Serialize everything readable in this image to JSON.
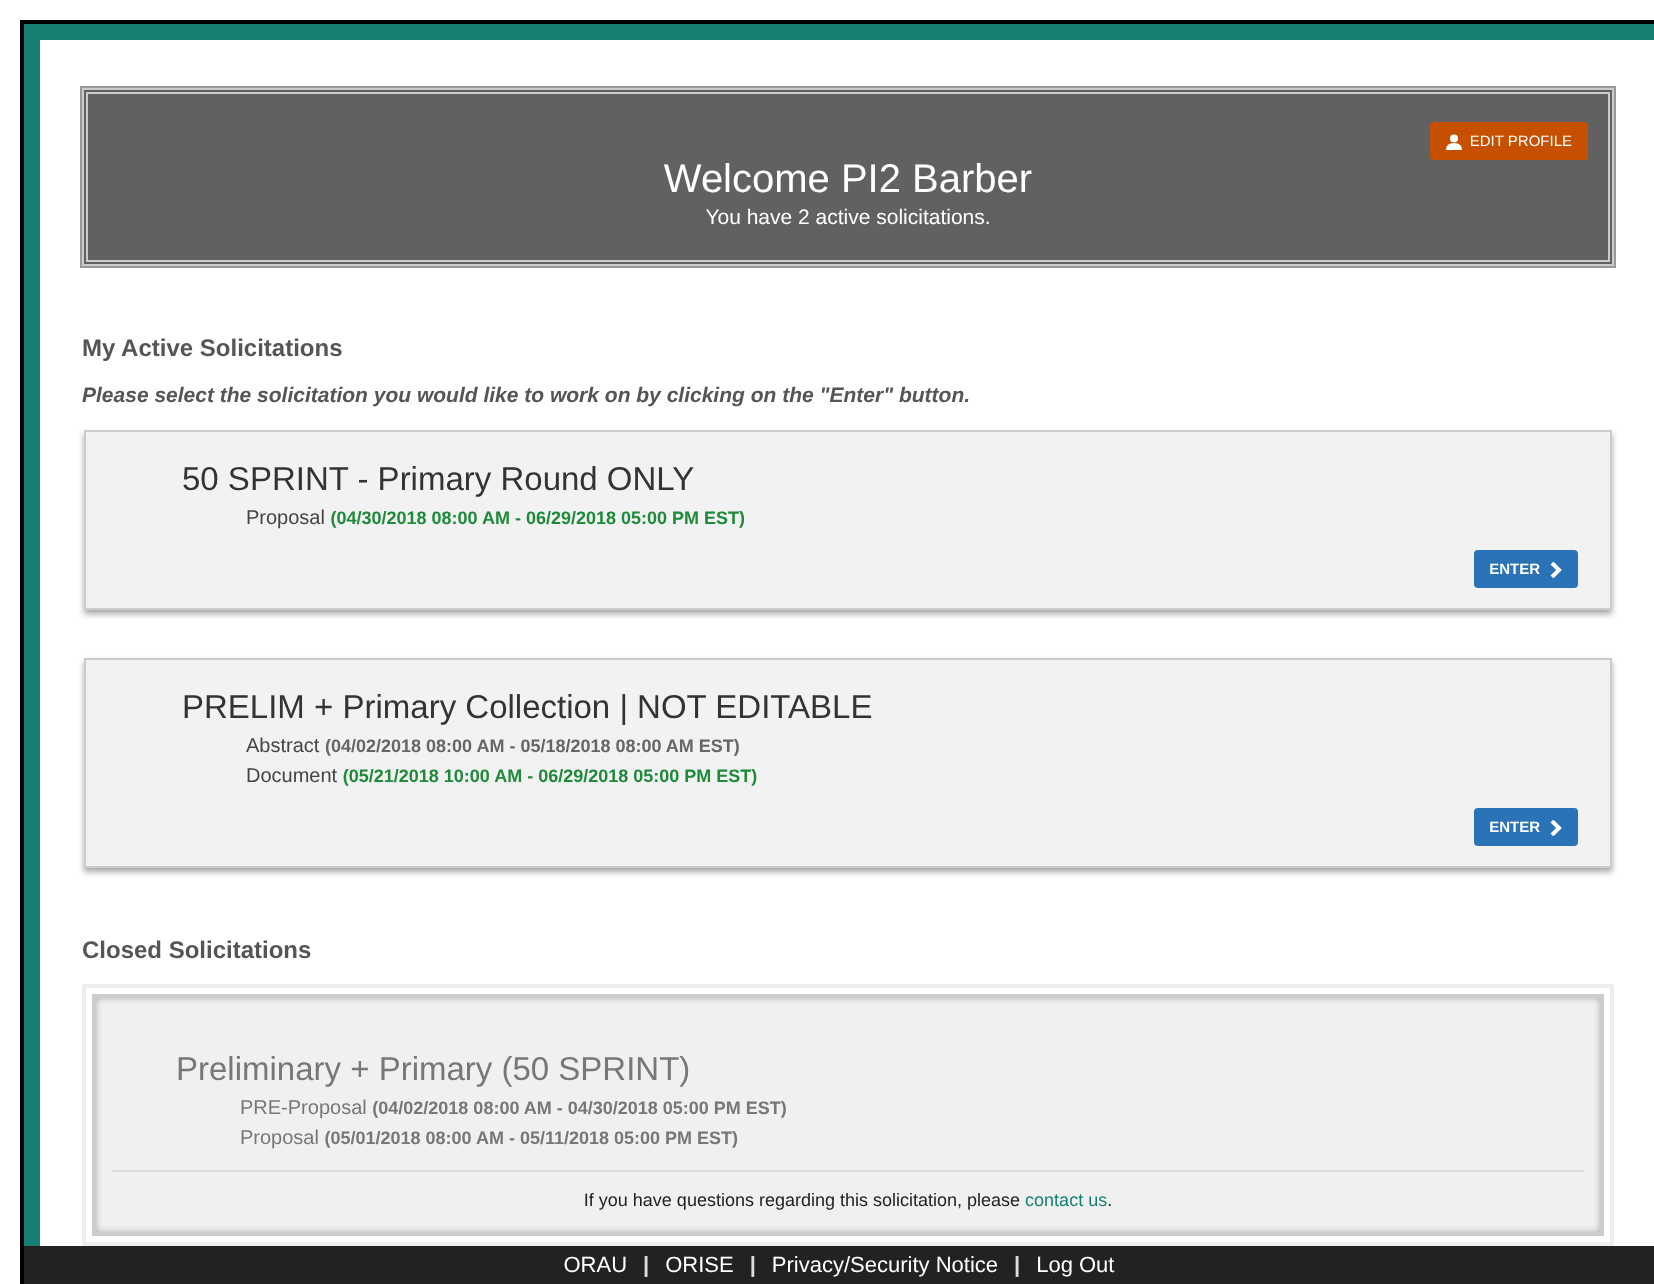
{
  "header": {
    "title": "Welcome PI2 Barber",
    "subtitle": "You have 2 active solicitations.",
    "edit_button": "EDIT PROFILE"
  },
  "active": {
    "heading": "My Active Solicitations",
    "instruction": "Please select the solicitation you would like to work on by clicking on the \"Enter\" button.",
    "solicitations": [
      {
        "title": "50 SPRINT - Primary Round ONLY",
        "phases": [
          {
            "name": "Proposal",
            "dates": "(04/30/2018 08:00 AM - 06/29/2018 05:00 PM EST)",
            "open": true
          }
        ],
        "button": "ENTER"
      },
      {
        "title": "PRELIM + Primary Collection | NOT EDITABLE",
        "phases": [
          {
            "name": "Abstract",
            "dates": "(04/02/2018 08:00 AM - 05/18/2018 08:00 AM EST)",
            "open": false
          },
          {
            "name": "Document",
            "dates": "(05/21/2018 10:00 AM - 06/29/2018 05:00 PM EST)",
            "open": true
          }
        ],
        "button": "ENTER"
      }
    ]
  },
  "closed": {
    "heading": "Closed Solicitations",
    "solicitations": [
      {
        "title": "Preliminary + Primary (50 SPRINT)",
        "phases": [
          {
            "name": "PRE-Proposal",
            "dates": "(04/02/2018 08:00 AM - 04/30/2018 05:00 PM EST)"
          },
          {
            "name": "Proposal",
            "dates": "(05/01/2018 08:00 AM - 05/11/2018 05:00 PM EST)"
          }
        ]
      }
    ],
    "note": {
      "text": "If you have questions regarding this solicitation, please",
      "link": "contact us",
      "end": "."
    }
  },
  "footer": {
    "items": [
      {
        "kind": "link",
        "text": "ORAU"
      },
      {
        "kind": "separator",
        "text": "|"
      },
      {
        "kind": "link",
        "text": "ORISE"
      },
      {
        "kind": "separator",
        "text": "|"
      },
      {
        "kind": "link",
        "text": "Privacy/Security Notice"
      },
      {
        "kind": "separator",
        "text": "|"
      },
      {
        "kind": "link",
        "text": "Log Out"
      }
    ]
  }
}
